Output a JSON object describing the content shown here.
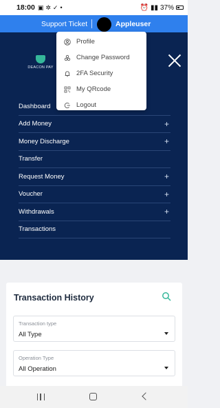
{
  "status_bar": {
    "time": "18:00",
    "battery": "37%"
  },
  "topbar": {
    "support_label": "Support Ticket",
    "username": "Appleuser"
  },
  "brand": {
    "logo_text": "DEACON PAY",
    "accent": "#35b79a",
    "header_color": "#2f80ed",
    "menu_bg": "#0a2452"
  },
  "user_menu": {
    "items": [
      {
        "label": "Profile",
        "icon": "user-icon"
      },
      {
        "label": "Change Password",
        "icon": "key-icon"
      },
      {
        "label": "2FA Security",
        "icon": "bell-icon"
      },
      {
        "label": "My QRcode",
        "icon": "qr-code-icon"
      },
      {
        "label": "Logout",
        "icon": "logout-icon"
      }
    ]
  },
  "nav": {
    "items": [
      {
        "label": "Dashboard",
        "expandable": false
      },
      {
        "label": "Add Money",
        "expandable": true
      },
      {
        "label": "Money Discharge",
        "expandable": true
      },
      {
        "label": "Transfer",
        "expandable": false
      },
      {
        "label": "Request Money",
        "expandable": true
      },
      {
        "label": "Voucher",
        "expandable": true
      },
      {
        "label": "Withdrawals",
        "expandable": true
      },
      {
        "label": "Transactions",
        "expandable": false
      }
    ],
    "expand_symbol": "+"
  },
  "transactions": {
    "title": "Transaction History",
    "transaction_type": {
      "label": "Transaction type",
      "value": "All Type"
    },
    "operation_type": {
      "label": "Operation Type",
      "value": "All Operation"
    }
  }
}
